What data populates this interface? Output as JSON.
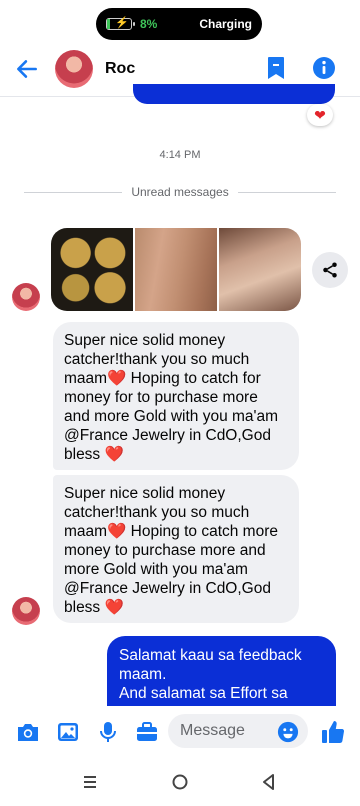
{
  "status_bar": {
    "battery_percent": "8%",
    "charging_label": "Charging",
    "battery_level": 0.08
  },
  "header": {
    "contact_name": "Roc",
    "icons": [
      "back-arrow-icon",
      "bookmark-icon",
      "info-icon"
    ]
  },
  "previous_message": {
    "reaction": "❤"
  },
  "timestamp": "4:14 PM",
  "divider": {
    "label": "Unread messages"
  },
  "photos": [
    "gold-coins-photo",
    "gold-rings-photo",
    "gold-rings-hand-photo"
  ],
  "messages": [
    {
      "direction": "incoming",
      "text": "Super nice solid money catcher!thank you so much maam❤️ Hoping to catch for money for to purchase more and more Gold with you ma'am @France Jewelry in CdO,God bless ❤️"
    },
    {
      "direction": "incoming",
      "text": "Super nice solid money catcher!thank you so much maam❤️ Hoping to catch more money to purchase more and more Gold with you ma'am @France Jewelry in CdO,God bless ❤️"
    },
    {
      "direction": "outgoing",
      "text": "Salamat kaau sa feedback maam.\nAnd salamat sa Effort sa"
    }
  ],
  "composer": {
    "placeholder": "Message",
    "icons": [
      "camera-icon",
      "gallery-icon",
      "microphone-icon",
      "briefcase-icon",
      "emoji-icon",
      "thumbs-up-icon"
    ]
  },
  "colors": {
    "accent": "#0b2fd6",
    "incoming_bubble": "#eff0f3",
    "heart": "#e3242b"
  }
}
